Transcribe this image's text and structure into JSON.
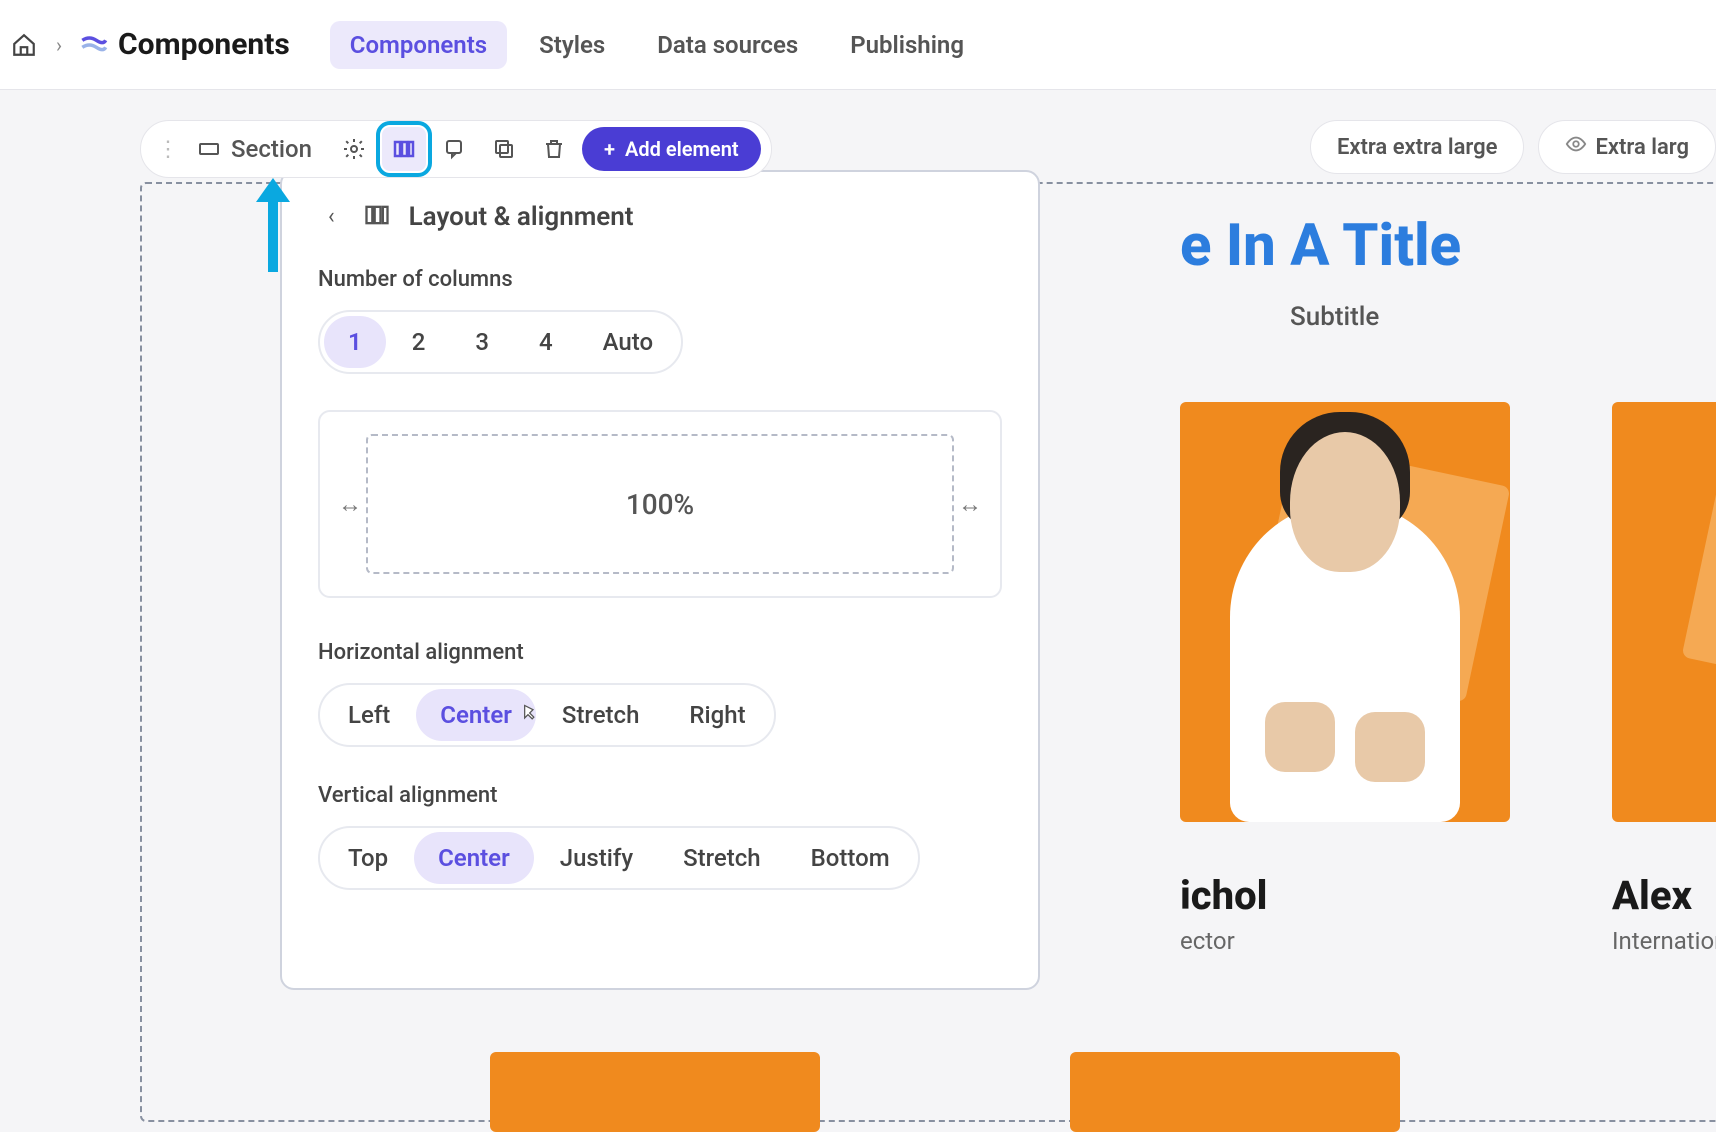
{
  "breadcrumb": {
    "title": "Components"
  },
  "nav_tabs": [
    {
      "label": "Components",
      "active": true
    },
    {
      "label": "Styles",
      "active": false
    },
    {
      "label": "Data sources",
      "active": false
    },
    {
      "label": "Publishing",
      "active": false
    }
  ],
  "toolbar": {
    "section_label": "Section",
    "add_element_label": "Add element"
  },
  "viewport_chips": {
    "primary": "Extra extra large",
    "secondary": "Extra larg"
  },
  "canvas_content": {
    "title_visible_fragment": "e In A Title",
    "subtitle": "Subtitle",
    "cards": [
      {
        "name_fragment": "ichol",
        "role_fragment": "ector"
      },
      {
        "name_fragment": "Alex",
        "role_fragment": "Internation"
      }
    ]
  },
  "popover": {
    "title": "Layout & alignment",
    "num_columns": {
      "label": "Number of columns",
      "options": [
        "1",
        "2",
        "3",
        "4",
        "Auto"
      ],
      "selected": "1"
    },
    "width_display": "100%",
    "horizontal_alignment": {
      "label": "Horizontal alignment",
      "options": [
        "Left",
        "Center",
        "Stretch",
        "Right"
      ],
      "selected": "Center"
    },
    "vertical_alignment": {
      "label": "Vertical alignment",
      "options": [
        "Top",
        "Center",
        "Justify",
        "Stretch",
        "Bottom"
      ],
      "selected": "Center"
    }
  },
  "colors": {
    "accent": "#5b4fe0",
    "highlight": "#0aa8e0",
    "orange": "#f08a1e",
    "title_blue": "#2c7dde"
  }
}
